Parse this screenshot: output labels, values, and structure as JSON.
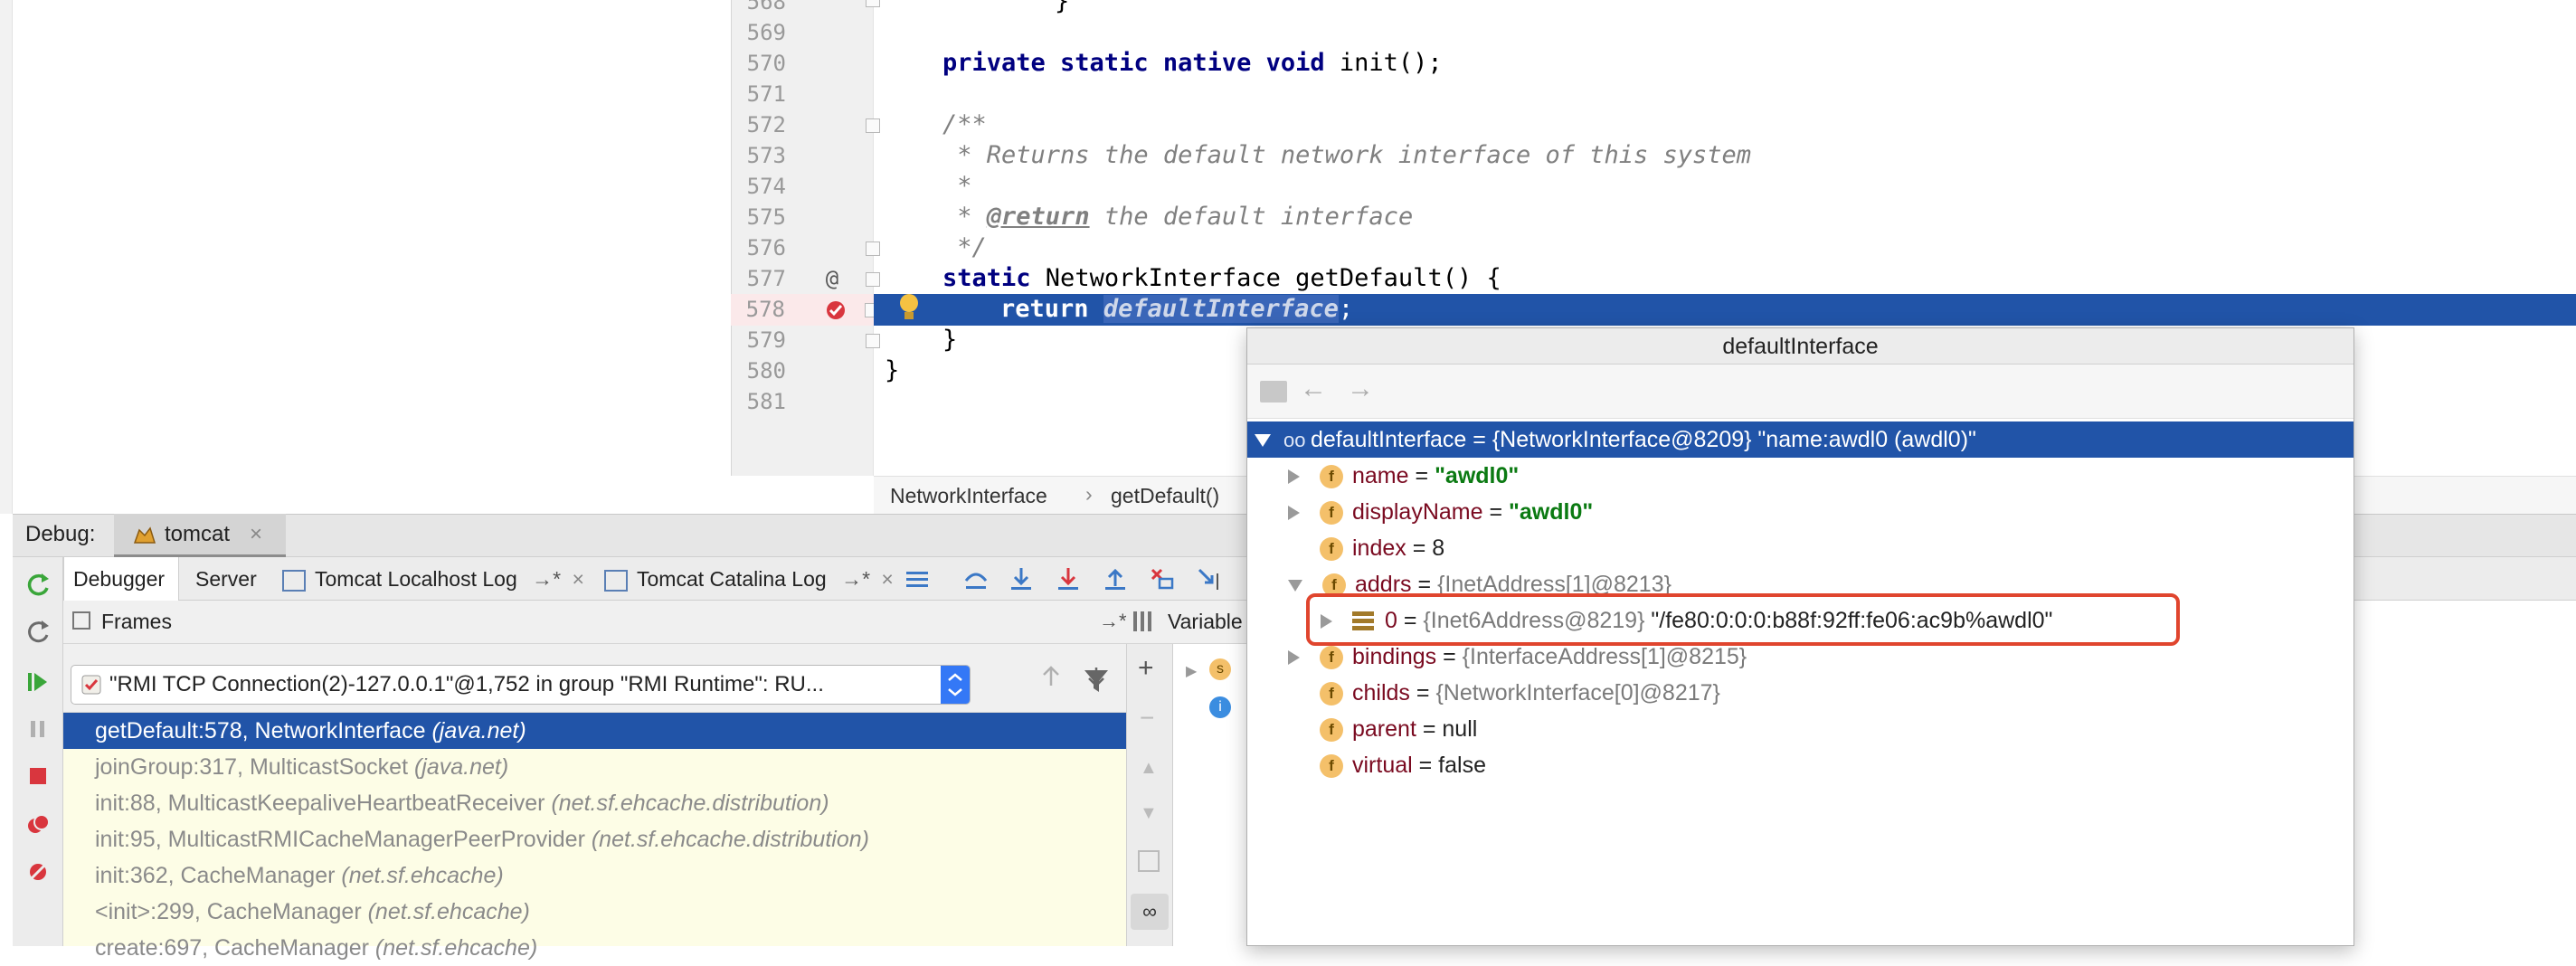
{
  "editor": {
    "lines": [
      {
        "num": "568",
        "text": "        }"
      },
      {
        "num": "569",
        "text": ""
      },
      {
        "num": "570",
        "kw": "private static native void",
        "text": " init();"
      },
      {
        "num": "571",
        "text": ""
      },
      {
        "num": "572",
        "cm": "/**"
      },
      {
        "num": "573",
        "cm": " * Returns the default network interface of this system"
      },
      {
        "num": "574",
        "cm": " *"
      },
      {
        "num": "575",
        "cm_tag": "@return",
        "cm": " the default interface"
      },
      {
        "num": "576",
        "cm": " */"
      },
      {
        "num": "577",
        "kw": "static",
        "text": " NetworkInterface getDefault() {"
      },
      {
        "num": "578",
        "kw": "return",
        "sel": "defaultInterface",
        "text": ";"
      },
      {
        "num": "579",
        "text": "}"
      },
      {
        "num": "580",
        "text": "}"
      },
      {
        "num": "581",
        "text": ""
      }
    ],
    "gutter_at": "@",
    "breadcrumbs": [
      "NetworkInterface",
      "getDefault()"
    ]
  },
  "debug": {
    "label": "Debug:",
    "session_tab": "tomcat",
    "tabs": [
      "Debugger",
      "Server",
      "Tomcat Localhost Log",
      "Tomcat Catalina Log"
    ],
    "tab_pin": "→*",
    "frames_label": "Frames",
    "frames_pin": "→*",
    "variables_label": "Variable",
    "thread": "\"RMI TCP Connection(2)-127.0.0.1\"@1,752 in group \"RMI Runtime\": RU...",
    "frames": [
      {
        "method": "getDefault:578, NetworkInterface",
        "pkg": "(java.net)"
      },
      {
        "method": "joinGroup:317, MulticastSocket",
        "pkg": "(java.net)"
      },
      {
        "method": "init:88, MulticastKeepaliveHeartbeatReceiver",
        "pkg": "(net.sf.ehcache.distribution)"
      },
      {
        "method": "init:95, MulticastRMICacheManagerPeerProvider",
        "pkg": "(net.sf.ehcache.distribution)"
      },
      {
        "method": "init:362, CacheManager",
        "pkg": "(net.sf.ehcache)"
      },
      {
        "method": "<init>:299, CacheManager",
        "pkg": "(net.sf.ehcache)"
      },
      {
        "method": "create:697, CacheManager",
        "pkg": "(net.sf.ehcache)"
      }
    ]
  },
  "popup": {
    "title": "defaultInterface",
    "root": "defaultInterface = {NetworkInterface@8209} \"name:awdl0 (awdl0)\"",
    "name_key": "name",
    "name_val": "\"awdl0\"",
    "display_key": "displayName",
    "display_val": "\"awdl0\"",
    "index_key": "index",
    "index_val": "= 8",
    "addrs_key": "addrs",
    "addrs_val": "{InetAddress[1]@8213}",
    "addr0_key": "0",
    "addr0_ref": "{Inet6Address@8219}",
    "addr0_val": "\"/fe80:0:0:0:b88f:92ff:fe06:ac9b%awdl0\"",
    "bindings_key": "bindings",
    "bindings_val": "{InterfaceAddress[1]@8215}",
    "childs_key": "childs",
    "childs_val": "{NetworkInterface[0]@8217}",
    "parent_key": "parent",
    "parent_val": "= null",
    "virtual_key": "virtual",
    "virtual_val": "= false",
    "eq": "=",
    "badge_f": "f"
  },
  "colors": {
    "selection": "#2154a8",
    "highlight_box": "#e0452e",
    "string_value": "#0b7a12"
  }
}
